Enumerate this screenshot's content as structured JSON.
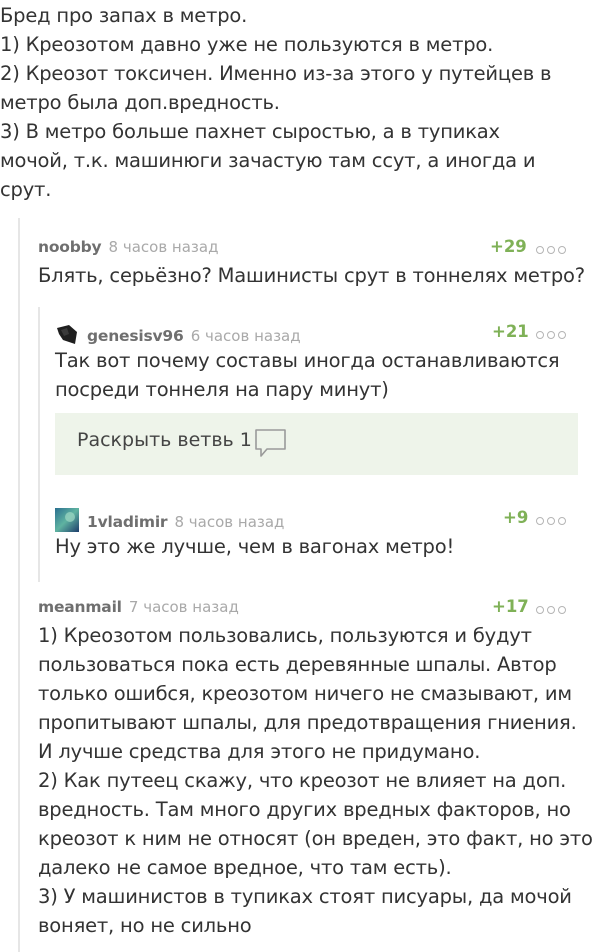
{
  "post": {
    "lines": [
      "Бред про запах в метро.",
      "1) Креозотом давно уже не пользуются в метро.",
      "2) Креозот токсичен. Именно из-за этого у путейцев в",
      "метро была доп.вредность.",
      "3) В метро больше пахнет сыростью, а в тупиках",
      "мочой, т.к. машинюги зачастую там ссут, а иногда и",
      "срут."
    ]
  },
  "comments": [
    {
      "author": "noobby",
      "time": "8 часов назад",
      "rating": "+29",
      "lines": [
        "Блять, серьёзно? Машинисты срут в тоннелях метро?"
      ]
    },
    {
      "author": "genesisv96",
      "time": "6 часов назад",
      "rating": "+21",
      "lines": [
        "Так вот почему составы иногда останавливаются",
        "посреди тоннеля на пару минут)"
      ]
    },
    {
      "author": "1vladimir",
      "time": "8 часов назад",
      "rating": "+9",
      "lines": [
        "Ну это же лучше, чем в вагонах метро!"
      ]
    },
    {
      "author": "meanmail",
      "time": "7 часов назад",
      "rating": "+17",
      "lines": [
        "1) Креозотом пользовались, пользуются и будут",
        "пользоваться пока есть деревянные шпалы. Автор",
        "только ошибся, креозотом ничего не смазывают, им",
        "пропитывают шпалы, для предотвращения гниения.",
        "И лучше средства для этого не придумано.",
        "2) Как путеец скажу, что креозот не влияет на доп.",
        "вредность. Там много других вредных факторов, но",
        "креозот к ним не относят (он вреден, это факт, но это",
        "далеко не самое вредное, что там есть).",
        "3) У машинистов в тупиках стоят писуары, да мочой",
        "воняет, но не сильно"
      ]
    }
  ],
  "expand_branch": {
    "label": "Раскрыть ветвь 1",
    "icon": "comment-bubble-icon"
  },
  "colors": {
    "rating": "#7fb157",
    "expand_bg": "#eef4ea",
    "thread_line": "#e6e6e6"
  }
}
